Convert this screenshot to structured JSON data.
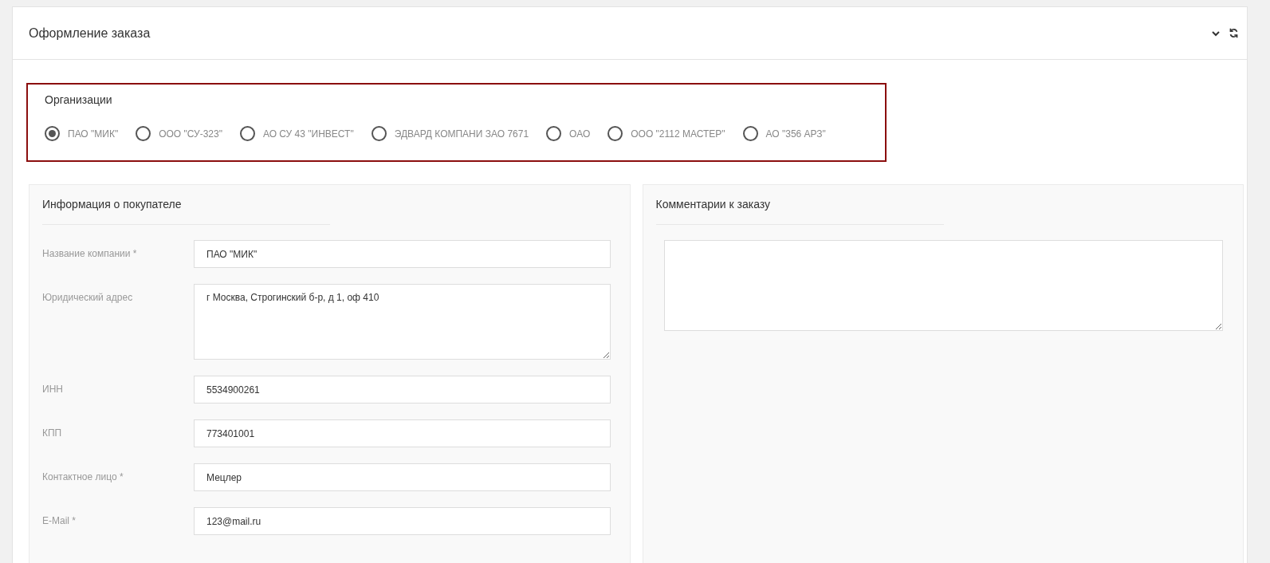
{
  "panel": {
    "title": "Оформление заказа"
  },
  "organizations": {
    "title": "Организации",
    "options": [
      {
        "label": "ПАО \"МИК\"",
        "selected": true
      },
      {
        "label": "ООО \"СУ-323\"",
        "selected": false
      },
      {
        "label": "АО СУ 43 \"ИНВЕСТ\"",
        "selected": false
      },
      {
        "label": "ЭДВАРД КОМПАНИ ЗАО 7671",
        "selected": false
      },
      {
        "label": "ОАО",
        "selected": false
      },
      {
        "label": "ООО \"2112 МАСТЕР\"",
        "selected": false
      },
      {
        "label": "АО \"356 АРЗ\"",
        "selected": false
      }
    ]
  },
  "buyer": {
    "title": "Информация о покупателе",
    "fields": [
      {
        "label": "Название компании *",
        "value": "ПАО \"МИК\"",
        "kind": "input"
      },
      {
        "label": "Юридический адрес",
        "value": "г Москва, Строгинский б-р, д 1, оф 410",
        "kind": "textarea"
      },
      {
        "label": "ИНН",
        "value": "5534900261",
        "kind": "input"
      },
      {
        "label": "КПП",
        "value": "773401001",
        "kind": "input"
      },
      {
        "label": "Контактное лицо *",
        "value": "Мецлер",
        "kind": "input"
      },
      {
        "label": "E-Mail *",
        "value": "123@mail.ru",
        "kind": "input"
      }
    ]
  },
  "comments": {
    "title": "Комментарии к заказу"
  }
}
